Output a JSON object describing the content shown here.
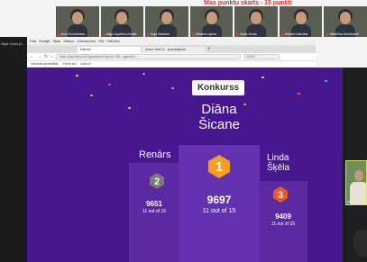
{
  "caption": "Max punktu skaits - 15 punkti",
  "participants": [
    {
      "name": "Ieva Grundmane"
    },
    {
      "name": "Aiga Legzdina-Cinata"
    },
    {
      "name": "Inga Sarkane"
    },
    {
      "name": "Kristine Lapina"
    },
    {
      "name": "Anda Ozola"
    },
    {
      "name": "Marina Dabolina"
    },
    {
      "name": "Valentina Dzelzkalne"
    }
  ],
  "host_label": "Signe Ozola (K...",
  "browser": {
    "menu": [
      "Fails",
      "Rediģēt",
      "Skats",
      "Vēsture",
      "Grāmatzīmes",
      "Rīki",
      "Palīdzība"
    ],
    "tabs": [
      {
        "label": "Kahoot!",
        "active": true
      },
      {
        "label": "Zoom: Ieva G... pieprasījums",
        "active": false
      }
    ],
    "url": "https://play.kahoot.it/v2/gameblock?quizId=1f5a...&gameId=...",
    "search_placeholder": "Meklēt",
    "bookmarks": [
      "Visbiežāk apmeklētās",
      "Pirmie soļi",
      "Kahoot!"
    ]
  },
  "podium": {
    "title": "Konkurss",
    "places": [
      {
        "rank": "1",
        "name_line1": "Diāna",
        "name_line2": "Šicane",
        "score": "9697",
        "out_of": "11 out of 15",
        "color": "#f2a01e"
      },
      {
        "rank": "2",
        "name_line1": "Renārs",
        "name_line2": "",
        "score": "9651",
        "out_of": "11 out of 15",
        "color": "#7a7a7a"
      },
      {
        "rank": "3",
        "name_line1": "Linda",
        "name_line2": "Šķēla",
        "score": "9409",
        "out_of": "11 out of 15",
        "color": "#e85c24"
      }
    ]
  },
  "colors": {
    "stage": "#46178f",
    "podium": "#5b2aa3",
    "gold": "#f2a01e",
    "silver": "#7a7a7a",
    "bronze": "#e85c24"
  },
  "webcam_label": "Ieva G..."
}
